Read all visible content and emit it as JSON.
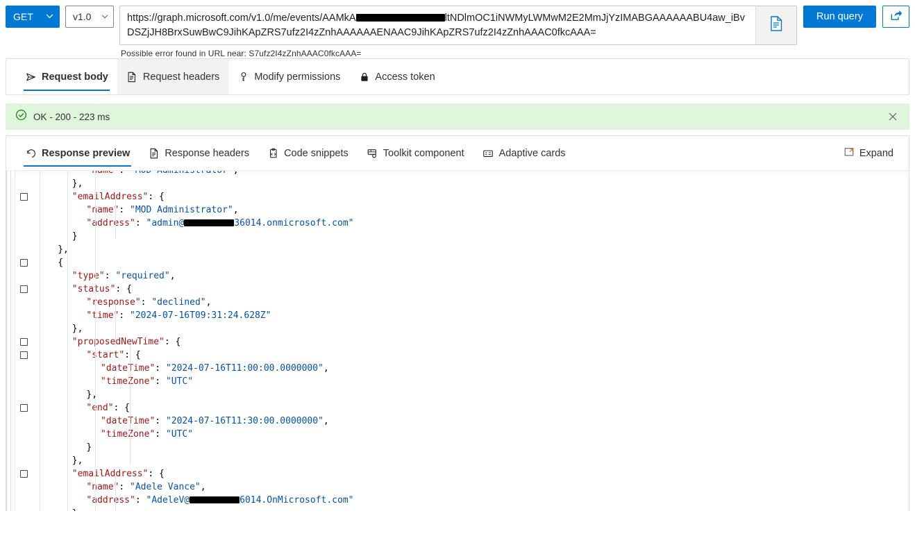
{
  "query_bar": {
    "method": "GET",
    "method_chevron": "chevron-down-icon",
    "version": "v1.0",
    "url_prefix": "https://graph.microsoft.com/v1.0/me/events/AAMkA",
    "url_redacted_label": "redacted",
    "url_mid": "ltNDlmOC1iNWMyLWMwM2E2MmJjYzIMABGAAAAAABU4aw_iBvDSZjJH8B",
    "url_suffix": "rxSuwBwC9JihKApZRS7ufz2I4zZnhAAAAAAENAAC9JihKApZRS7ufz2I4zZnhAAAC0fkcAAA=",
    "doc_icon": "document-icon",
    "error_hint": "Possible error found in URL near: S7ufz2I4zZnhAAAC0fkcAAA=",
    "run_query_label": "Run query",
    "share_icon": "share-icon"
  },
  "request_tabs": [
    {
      "label": "Request body",
      "icon": "send-paper-plane-icon",
      "active": true,
      "hovered": false
    },
    {
      "label": "Request headers",
      "icon": "document-lines-icon",
      "active": false,
      "hovered": true
    },
    {
      "label": "Modify permissions",
      "icon": "key-person-icon",
      "active": false,
      "hovered": false
    },
    {
      "label": "Access token",
      "icon": "lock-icon",
      "active": false,
      "hovered": false
    }
  ],
  "status": {
    "icon": "check-circle-icon",
    "text": "OK - 200 - 223 ms",
    "close_icon": "close-icon",
    "background_color": "#dff6dd"
  },
  "response_tabs": [
    {
      "label": "Response preview",
      "icon": "history-back-arrow-icon",
      "active": true
    },
    {
      "label": "Response headers",
      "icon": "document-lines-icon",
      "active": false
    },
    {
      "label": "Code snippets",
      "icon": "code-clipboard-icon",
      "active": false
    },
    {
      "label": "Toolkit component",
      "icon": "toolkit-grid-icon",
      "active": false
    },
    {
      "label": "Adaptive cards",
      "icon": "card-icon",
      "active": false
    }
  ],
  "expand": {
    "label": "Expand",
    "icon": "expand-icon"
  },
  "theme": {
    "accent": "#0078d4",
    "json_key_color": "#a31515",
    "json_string_color": "#0451a5",
    "json_punct_color": "#000000"
  },
  "response_body": {
    "language": "json",
    "lines": [
      {
        "indent": 4,
        "checkbox": false,
        "clipped": true,
        "segments": [
          {
            "t": "k",
            "v": "\"name\""
          },
          {
            "t": "p",
            "v": ": "
          },
          {
            "t": "s",
            "v": "\"MOD Administrator\""
          },
          {
            "t": "p",
            "v": ","
          }
        ]
      },
      {
        "indent": 3,
        "checkbox": false,
        "segments": [
          {
            "t": "p",
            "v": "},"
          }
        ]
      },
      {
        "indent": 3,
        "checkbox": true,
        "segments": [
          {
            "t": "k",
            "v": "\"emailAddress\""
          },
          {
            "t": "p",
            "v": ": {"
          }
        ]
      },
      {
        "indent": 4,
        "checkbox": false,
        "segments": [
          {
            "t": "k",
            "v": "\"name\""
          },
          {
            "t": "p",
            "v": ": "
          },
          {
            "t": "s",
            "v": "\"MOD Administrator\""
          },
          {
            "t": "p",
            "v": ","
          }
        ]
      },
      {
        "indent": 4,
        "checkbox": false,
        "redact": {
          "after": "\"admin@",
          "width": 78
        },
        "segments": [
          {
            "t": "k",
            "v": "\"address\""
          },
          {
            "t": "p",
            "v": ": "
          },
          {
            "t": "s",
            "v": "\"admin@"
          },
          {
            "t": "redact",
            "v": ""
          },
          {
            "t": "s",
            "v": "36014.onmicrosoft.com\""
          }
        ]
      },
      {
        "indent": 3,
        "checkbox": false,
        "segments": [
          {
            "t": "p",
            "v": "}"
          }
        ]
      },
      {
        "indent": 2,
        "checkbox": false,
        "segments": [
          {
            "t": "p",
            "v": "},"
          }
        ]
      },
      {
        "indent": 2,
        "checkbox": true,
        "segments": [
          {
            "t": "p",
            "v": "{"
          }
        ]
      },
      {
        "indent": 3,
        "checkbox": false,
        "segments": [
          {
            "t": "k",
            "v": "\"type\""
          },
          {
            "t": "p",
            "v": ": "
          },
          {
            "t": "s",
            "v": "\"required\""
          },
          {
            "t": "p",
            "v": ","
          }
        ]
      },
      {
        "indent": 3,
        "checkbox": true,
        "segments": [
          {
            "t": "k",
            "v": "\"status\""
          },
          {
            "t": "p",
            "v": ": {"
          }
        ]
      },
      {
        "indent": 4,
        "checkbox": false,
        "segments": [
          {
            "t": "k",
            "v": "\"response\""
          },
          {
            "t": "p",
            "v": ": "
          },
          {
            "t": "s",
            "v": "\"declined\""
          },
          {
            "t": "p",
            "v": ","
          }
        ]
      },
      {
        "indent": 4,
        "checkbox": false,
        "segments": [
          {
            "t": "k",
            "v": "\"time\""
          },
          {
            "t": "p",
            "v": ": "
          },
          {
            "t": "s",
            "v": "\"2024-07-16T09:31:24.628Z\""
          }
        ]
      },
      {
        "indent": 3,
        "checkbox": false,
        "segments": [
          {
            "t": "p",
            "v": "},"
          }
        ]
      },
      {
        "indent": 3,
        "checkbox": true,
        "segments": [
          {
            "t": "k",
            "v": "\"proposedNewTime\""
          },
          {
            "t": "p",
            "v": ": {"
          }
        ]
      },
      {
        "indent": 4,
        "checkbox": true,
        "segments": [
          {
            "t": "k",
            "v": "\"start\""
          },
          {
            "t": "p",
            "v": ": {"
          }
        ]
      },
      {
        "indent": 5,
        "checkbox": false,
        "segments": [
          {
            "t": "k",
            "v": "\"dateTime\""
          },
          {
            "t": "p",
            "v": ": "
          },
          {
            "t": "s",
            "v": "\"2024-07-16T11:00:00.0000000\""
          },
          {
            "t": "p",
            "v": ","
          }
        ]
      },
      {
        "indent": 5,
        "checkbox": false,
        "segments": [
          {
            "t": "k",
            "v": "\"timeZone\""
          },
          {
            "t": "p",
            "v": ": "
          },
          {
            "t": "s",
            "v": "\"UTC\""
          }
        ]
      },
      {
        "indent": 4,
        "checkbox": false,
        "segments": [
          {
            "t": "p",
            "v": "},"
          }
        ]
      },
      {
        "indent": 4,
        "checkbox": true,
        "segments": [
          {
            "t": "k",
            "v": "\"end\""
          },
          {
            "t": "p",
            "v": ": {"
          }
        ]
      },
      {
        "indent": 5,
        "checkbox": false,
        "segments": [
          {
            "t": "k",
            "v": "\"dateTime\""
          },
          {
            "t": "p",
            "v": ": "
          },
          {
            "t": "s",
            "v": "\"2024-07-16T11:30:00.0000000\""
          },
          {
            "t": "p",
            "v": ","
          }
        ]
      },
      {
        "indent": 5,
        "checkbox": false,
        "segments": [
          {
            "t": "k",
            "v": "\"timeZone\""
          },
          {
            "t": "p",
            "v": ": "
          },
          {
            "t": "s",
            "v": "\"UTC\""
          }
        ]
      },
      {
        "indent": 4,
        "checkbox": false,
        "segments": [
          {
            "t": "p",
            "v": "}"
          }
        ]
      },
      {
        "indent": 3,
        "checkbox": false,
        "segments": [
          {
            "t": "p",
            "v": "},"
          }
        ]
      },
      {
        "indent": 3,
        "checkbox": true,
        "segments": [
          {
            "t": "k",
            "v": "\"emailAddress\""
          },
          {
            "t": "p",
            "v": ": {"
          }
        ]
      },
      {
        "indent": 4,
        "checkbox": false,
        "segments": [
          {
            "t": "k",
            "v": "\"name\""
          },
          {
            "t": "p",
            "v": ": "
          },
          {
            "t": "s",
            "v": "\"Adele Vance\""
          },
          {
            "t": "p",
            "v": ","
          }
        ]
      },
      {
        "indent": 4,
        "checkbox": false,
        "segments": [
          {
            "t": "k",
            "v": "\"address\""
          },
          {
            "t": "p",
            "v": ": "
          },
          {
            "t": "s",
            "v": "\"AdeleV@"
          },
          {
            "t": "redact",
            "v": ""
          },
          {
            "t": "s",
            "v": "6014.OnMicrosoft.com\""
          }
        ]
      },
      {
        "indent": 3,
        "checkbox": false,
        "segments": [
          {
            "t": "p",
            "v": "}"
          }
        ]
      },
      {
        "indent": 2,
        "checkbox": false,
        "segments": [
          {
            "t": "p",
            "v": "}"
          }
        ]
      },
      {
        "indent": 1,
        "checkbox": false,
        "segments": [
          {
            "t": "p",
            "v": "]"
          }
        ]
      }
    ]
  }
}
